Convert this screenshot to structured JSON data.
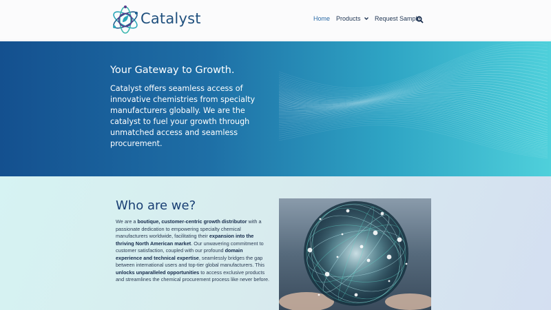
{
  "header": {
    "brand": "Catalyst",
    "nav": [
      {
        "label": "Home",
        "active": true
      },
      {
        "label": "Products",
        "has_dropdown": true
      },
      {
        "label": "Request Sample"
      }
    ],
    "search_icon": "search-icon",
    "accent_color": "#2a6aa6",
    "brand_color": "#20507e"
  },
  "hero": {
    "title": "Your Gateway to Growth.",
    "text": "Catalyst offers seamless access of innovative chemistries from specialty manufacturers globally.  We are the catalyst to fuel your growth through unmatched access and seamless procurement.",
    "gradient": [
      "#14508f",
      "#4fd0db"
    ]
  },
  "about": {
    "title": "Who are we?",
    "paragraph": [
      {
        "text": "We are a ",
        "bold": false
      },
      {
        "text": "boutique, customer-centric growth distributor",
        "bold": true
      },
      {
        "text": " with a passionate dedication to empowering specialty chemical manufacturers worldwide, facilitating their ",
        "bold": false
      },
      {
        "text": "expansion into the thriving North American market",
        "bold": true
      },
      {
        "text": ". Our unwavering commitment to customer satisfaction, coupled with our profound ",
        "bold": false
      },
      {
        "text": "domain experience and technical expertise",
        "bold": true
      },
      {
        "text": ", seamlessly bridges the gap between international users and top-tier global manufacturers. This ",
        "bold": false
      },
      {
        "text": "unlocks unparalleled opportunities",
        "bold": true
      },
      {
        "text": " to access exclusive products and streamlines the chemical procurement process like never before.",
        "bold": false
      }
    ]
  }
}
